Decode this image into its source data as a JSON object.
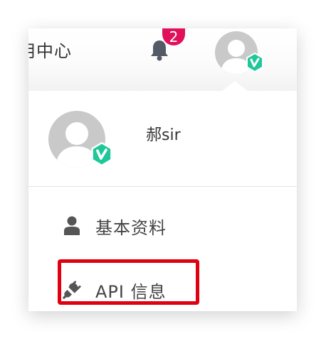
{
  "header": {
    "title": "用中心",
    "notification_count": "2"
  },
  "user": {
    "name": "郝sir",
    "vip_badge": "vip-icon"
  },
  "menu": {
    "items": [
      {
        "label": "基本资料",
        "icon": "user-icon"
      },
      {
        "label": "API 信息",
        "icon": "plug-icon"
      }
    ]
  },
  "colors": {
    "badge": "#e0105a",
    "vip": "#1fc79a",
    "highlight": "#e0000f",
    "text": "#333333"
  }
}
